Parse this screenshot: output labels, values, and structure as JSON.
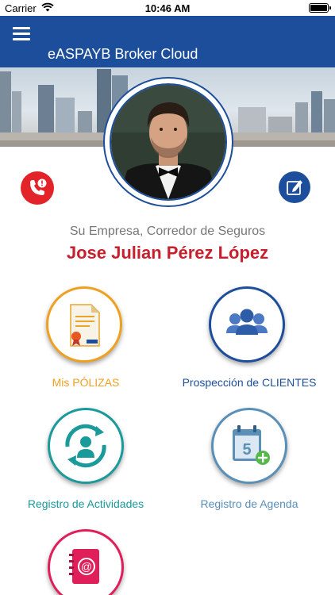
{
  "status_bar": {
    "carrier": "Carrier",
    "time": "10:46 AM"
  },
  "nav": {
    "title": "eASPAYB Broker Cloud",
    "menu_icon": "hamburger-icon"
  },
  "profile": {
    "company": "Su Empresa, Corredor de Seguros",
    "name": "Jose Julian Pérez López"
  },
  "actions": {
    "emergency_icon": "phone-alert-icon",
    "edit_icon": "edit-icon"
  },
  "tiles": [
    {
      "label": "Mis PÓLIZAS",
      "color": "#f0a020",
      "icon": "policy-document-icon"
    },
    {
      "label": "Prospección de CLIENTES",
      "color": "#1d4e9b",
      "icon": "clients-group-icon"
    },
    {
      "label": "Registro de Actividades",
      "color": "#1a9a9a",
      "icon": "activities-cycle-icon"
    },
    {
      "label": "Registro de Agenda",
      "color": "#5a8fb8",
      "icon": "calendar-add-icon"
    },
    {
      "label": "",
      "color": "#e01f5a",
      "icon": "address-book-icon"
    }
  ],
  "colors": {
    "brand": "#1d4e9b",
    "accent_red": "#c7202d"
  }
}
